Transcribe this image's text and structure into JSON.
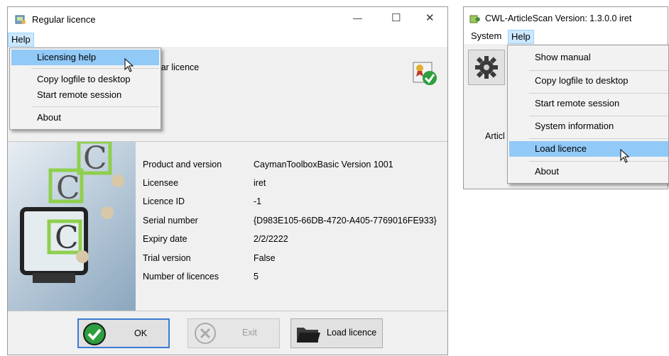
{
  "left_window": {
    "title": "Regular licence",
    "controls": {
      "minimize": "—",
      "maximize": "☐",
      "close": "✕"
    },
    "menu": {
      "help_label": "Help"
    },
    "help_menu": {
      "items": [
        "Licensing help",
        "Copy logfile to desktop",
        "Start remote session",
        "About"
      ],
      "highlighted_index": 0
    },
    "header_text_partial": "ular licence",
    "info": {
      "rows": [
        {
          "label": "Product and version",
          "value": "CaymanToolboxBasic  Version 1001"
        },
        {
          "label": "Licensee",
          "value": "iret"
        },
        {
          "label": "Licence ID",
          "value": "-1"
        },
        {
          "label": "Serial number",
          "value": "{D983E105-66DB-4720-A405-7769016FE933}"
        },
        {
          "label": "Expiry date",
          "value": "2/2/2222"
        },
        {
          "label": "Trial version",
          "value": "False"
        },
        {
          "label": "Number of licences",
          "value": "5"
        }
      ]
    },
    "buttons": {
      "ok": "OK",
      "exit": "Exit",
      "load": "Load licence"
    }
  },
  "right_window": {
    "title": "CWL-ArticleScan  Version: 1.3.0.0  iret",
    "menu": {
      "system_label": "System",
      "help_label": "Help"
    },
    "partial_label": "Articl",
    "help_menu": {
      "items": [
        "Show manual",
        "Copy logfile to desktop",
        "Start remote session",
        "System information",
        "Load licence",
        "About"
      ],
      "highlighted_index": 4
    }
  },
  "colors": {
    "menu_highlight": "#91c9f7",
    "menu_open": "#cce8ff",
    "ok_focus_border": "#3b7bd1",
    "check_green": "#2e9e3e"
  },
  "icons": [
    "app-licence-icon",
    "certificate-check-icon",
    "check-icon",
    "cancel-icon",
    "folder-icon",
    "gear-icon",
    "arrow-cursor-icon",
    "app-leaf-icon"
  ]
}
